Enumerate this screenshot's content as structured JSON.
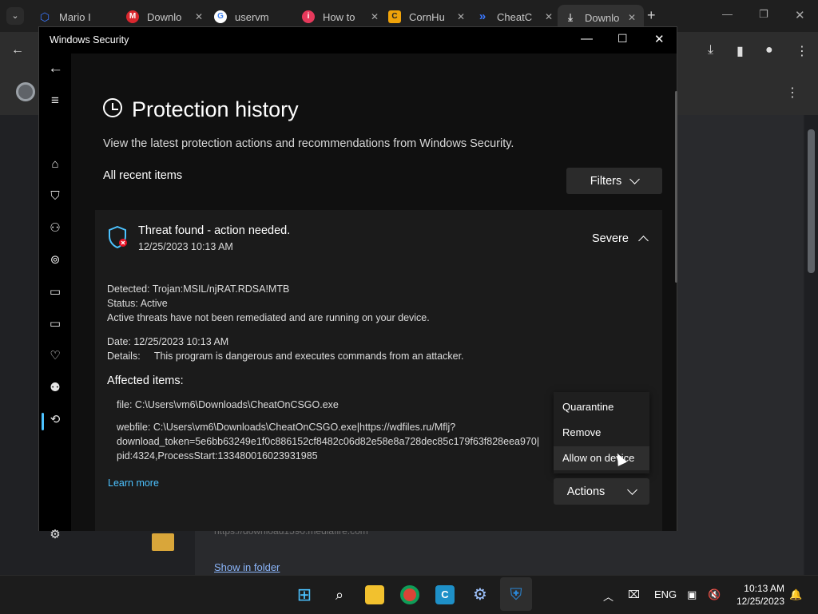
{
  "browser": {
    "tabs": [
      {
        "label": "Mario I",
        "icon": "hex-icon",
        "color": "#3b78ff"
      },
      {
        "label": "Downlo",
        "icon": "mega-icon",
        "color": "#d9272e"
      },
      {
        "label": "uservm",
        "icon": "google-icon",
        "color": "#4285f4"
      },
      {
        "label": "How to",
        "icon": "instructables-icon",
        "color": "#e5395b"
      },
      {
        "label": "CornHu",
        "icon": "cornhub-icon",
        "color": "#f0a30a"
      },
      {
        "label": "CheatC",
        "icon": "chevrons-icon",
        "color": "#3b78ff"
      },
      {
        "label": "Downlo",
        "icon": "download-icon",
        "color": "#cfcfcf"
      }
    ],
    "page": {
      "url_text": "https://download1590.mediafire.com",
      "show_in_folder": "Show in folder"
    }
  },
  "window": {
    "title": "Windows Security"
  },
  "main": {
    "title": "Protection history",
    "subtitle": "View the latest protection actions and recommendations from Windows Security.",
    "recent_label": "All recent items",
    "filters_label": "Filters"
  },
  "threat": {
    "title": "Threat found - action needed.",
    "date": "12/25/2023 10:13 AM",
    "severity": "Severe",
    "detected": "Detected:  Trojan:MSIL/njRAT.RDSA!MTB",
    "status": "Status:  Active",
    "status_note": "Active threats have not been remediated and are running on your device.",
    "date_line": "Date:  12/25/2023 10:13 AM",
    "details": "Details:     This program is dangerous and executes commands from an attacker.",
    "affected_label": "Affected items:",
    "file_item": "file: C:\\Users\\vm6\\Downloads\\CheatOnCSGO.exe",
    "webfile_1": "webfile: C:\\Users\\vm6\\Downloads\\CheatOnCSGO.exe|https://wdfiles.ru/Mflj?",
    "webfile_2": "download_token=5e6bb63249e1f0c886152cf8482c06d82e58e8a728dec85c179f63f828eea970|",
    "webfile_3": "pid:4324,ProcessStart:133480016023931985",
    "learn_more": "Learn more"
  },
  "actions_menu": {
    "items": [
      "Quarantine",
      "Remove",
      "Allow on device"
    ],
    "button_label": "Actions"
  },
  "taskbar": {
    "lang": "ENG",
    "time": "10:13 AM",
    "date": "12/25/2023"
  }
}
